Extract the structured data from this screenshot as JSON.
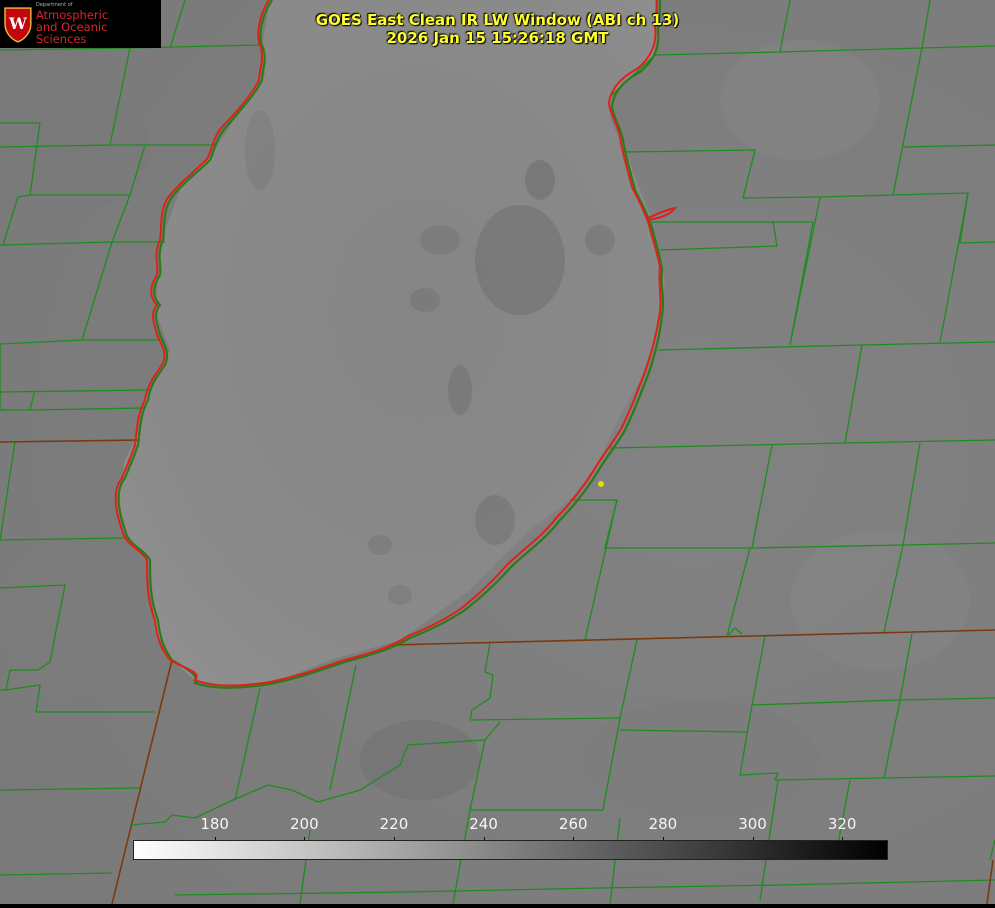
{
  "logo": {
    "dept": "Department of",
    "line1": "Atmospheric",
    "line2": "and Oceanic Sciences",
    "emblem_letter": "W"
  },
  "title": {
    "line1": "GOES East Clean IR LW Window (ABI ch 13)",
    "line2": "2026 Jan 15 15:26:18 GMT"
  },
  "colorbar": {
    "min": 162,
    "max": 330,
    "ticks": [
      "180",
      "200",
      "220",
      "240",
      "260",
      "280",
      "300",
      "320"
    ]
  },
  "colors": {
    "county_lines": "#1e8c1e",
    "lake_outline": "#e0201a",
    "title_text": "#ffff30",
    "marker": "#e0e000"
  },
  "icons": [
    "uw-crest-icon",
    "location-marker-icon"
  ]
}
